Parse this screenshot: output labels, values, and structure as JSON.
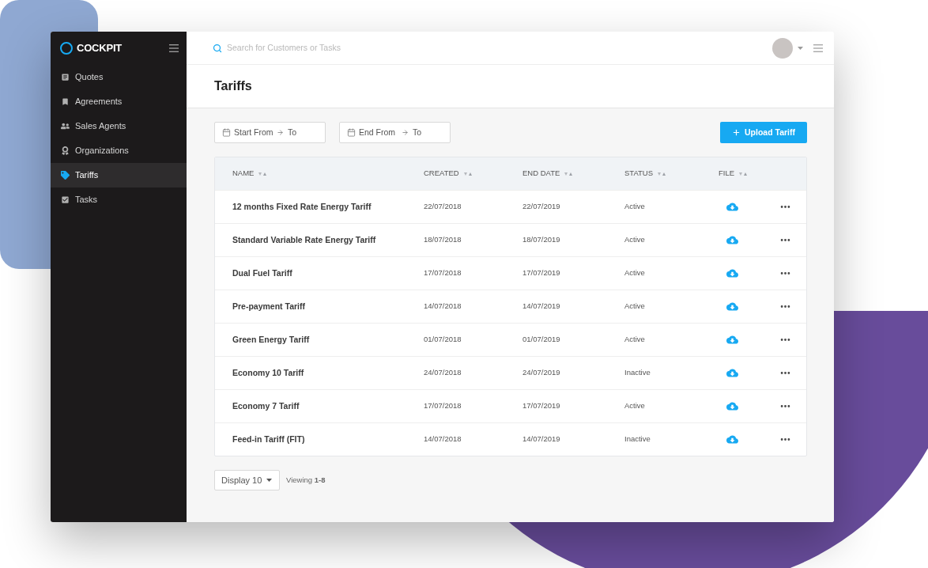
{
  "sidebar": {
    "logo": "COCKPIT",
    "items": [
      {
        "label": "Quotes",
        "selected": false
      },
      {
        "label": "Agreements",
        "selected": false
      },
      {
        "label": "Sales Agents",
        "selected": false
      },
      {
        "label": "Organizations",
        "selected": false
      },
      {
        "label": "Tariffs",
        "selected": true
      },
      {
        "label": "Tasks",
        "selected": false
      }
    ]
  },
  "header": {
    "search": {
      "placeholder": "Search for Customers or Tasks"
    }
  },
  "page": {
    "title": "Tariffs"
  },
  "filters": [
    {
      "from_placeholder": "Start From",
      "to_placeholder": "To"
    },
    {
      "from_placeholder": "End From",
      "to_placeholder": "To"
    }
  ],
  "upload_button": {
    "label": "Upload Tariff"
  },
  "table": {
    "columns": [
      "NAME",
      "CREATED",
      "END DATE",
      "STATUS",
      "FILE"
    ],
    "rows": [
      {
        "name": "12 months Fixed Rate Energy Tariff",
        "created": "22/07/2018",
        "end_date": "22/07/2019",
        "status": "Active"
      },
      {
        "name": "Standard Variable Rate Energy Tariff",
        "created": "18/07/2018",
        "end_date": "18/07/2019",
        "status": "Active"
      },
      {
        "name": "Dual Fuel Tariff",
        "created": "17/07/2018",
        "end_date": "17/07/2019",
        "status": "Active"
      },
      {
        "name": "Pre-payment Tariff",
        "created": "14/07/2018",
        "end_date": "14/07/2019",
        "status": "Active"
      },
      {
        "name": "Green Energy Tariff",
        "created": "01/07/2018",
        "end_date": "01/07/2019",
        "status": "Active"
      },
      {
        "name": "Economy 10 Tariff",
        "created": "24/07/2018",
        "end_date": "24/07/2019",
        "status": "Inactive"
      },
      {
        "name": "Economy 7 Tariff",
        "created": "17/07/2018",
        "end_date": "17/07/2019",
        "status": "Active"
      },
      {
        "name": "Feed-in Tariff (FIT)",
        "created": "14/07/2018",
        "end_date": "14/07/2019",
        "status": "Inactive"
      }
    ]
  },
  "footer": {
    "page_size": "Display 10",
    "viewing": "Viewing **1-8**"
  }
}
